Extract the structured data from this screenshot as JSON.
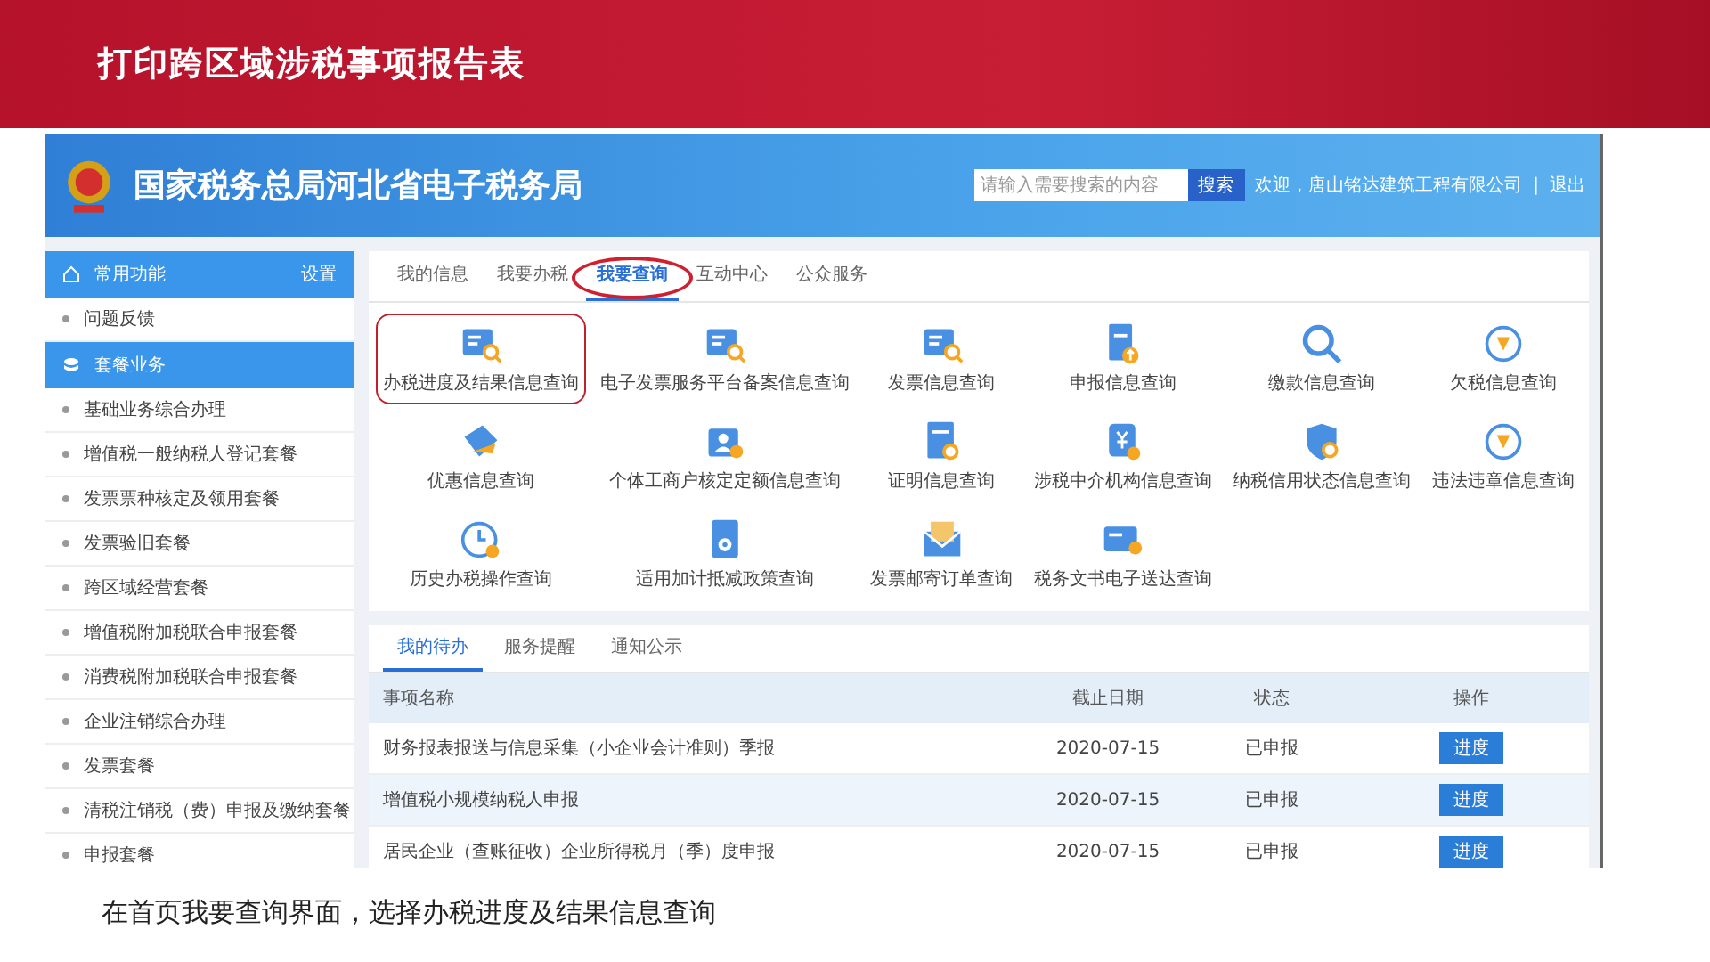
{
  "slide_title": "打印跨区域涉税事项报告表",
  "header": {
    "site_title": "国家税务总局河北省电子税务局",
    "search": {
      "placeholder": "请输入需要搜索的内容"
    },
    "search_button": "搜索",
    "welcome": "欢迎，唐山铭达建筑工程有限公司",
    "separator": "|",
    "logout": "退出"
  },
  "sidebar": {
    "sections": [
      {
        "title": "常用功能",
        "action": "设置",
        "items": [
          "问题反馈"
        ]
      },
      {
        "title": "套餐业务",
        "items": [
          "基础业务综合办理",
          "增值税一般纳税人登记套餐",
          "发票票种核定及领用套餐",
          "发票验旧套餐",
          "跨区域经营套餐",
          "增值税附加税联合申报套餐",
          "消费税附加税联合申报套餐",
          "企业注销综合办理",
          "发票套餐",
          "清税注销税（费）申报及缴纳套餐",
          "申报套餐"
        ]
      }
    ]
  },
  "main_tabs": [
    {
      "label": "我的信息",
      "selected": false,
      "circled": false
    },
    {
      "label": "我要办税",
      "selected": false,
      "circled": false
    },
    {
      "label": "我要查询",
      "selected": true,
      "circled": true
    },
    {
      "label": "互动中心",
      "selected": false,
      "circled": false
    },
    {
      "label": "公众服务",
      "selected": false,
      "circled": false
    }
  ],
  "query_items": [
    {
      "label": "办税进度及结果信息查询",
      "highlighted": true
    },
    {
      "label": "电子发票服务平台备案信息查询",
      "highlighted": false
    },
    {
      "label": "发票信息查询",
      "highlighted": false
    },
    {
      "label": "申报信息查询",
      "highlighted": false
    },
    {
      "label": "缴款信息查询",
      "highlighted": false
    },
    {
      "label": "欠税信息查询",
      "highlighted": false
    },
    {
      "label": "优惠信息查询",
      "highlighted": false
    },
    {
      "label": "个体工商户核定定额信息查询",
      "highlighted": false
    },
    {
      "label": "证明信息查询",
      "highlighted": false
    },
    {
      "label": "涉税中介机构信息查询",
      "highlighted": false
    },
    {
      "label": "纳税信用状态信息查询",
      "highlighted": false
    },
    {
      "label": "违法违章信息查询",
      "highlighted": false
    },
    {
      "label": "历史办税操作查询",
      "highlighted": false
    },
    {
      "label": "适用加计抵减政策查询",
      "highlighted": false
    },
    {
      "label": "发票邮寄订单查询",
      "highlighted": false
    },
    {
      "label": "税务文书电子送达查询",
      "highlighted": false
    }
  ],
  "todo_tabs": [
    {
      "label": "我的待办",
      "selected": true
    },
    {
      "label": "服务提醒",
      "selected": false
    },
    {
      "label": "通知公示",
      "selected": false
    }
  ],
  "table": {
    "columns": [
      "事项名称",
      "截止日期",
      "状态",
      "操作"
    ],
    "rows": [
      {
        "name": "财务报表报送与信息采集（小企业会计准则）季报",
        "deadline": "2020-07-15",
        "status": "已申报",
        "action": "进度"
      },
      {
        "name": "增值税小规模纳税人申报",
        "deadline": "2020-07-15",
        "status": "已申报",
        "action": "进度"
      },
      {
        "name": "居民企业（查账征收）企业所得税月（季）度申报",
        "deadline": "2020-07-15",
        "status": "已申报",
        "action": "进度"
      }
    ]
  },
  "caption": "在首页我要查询界面，选择办税进度及结果信息查询"
}
